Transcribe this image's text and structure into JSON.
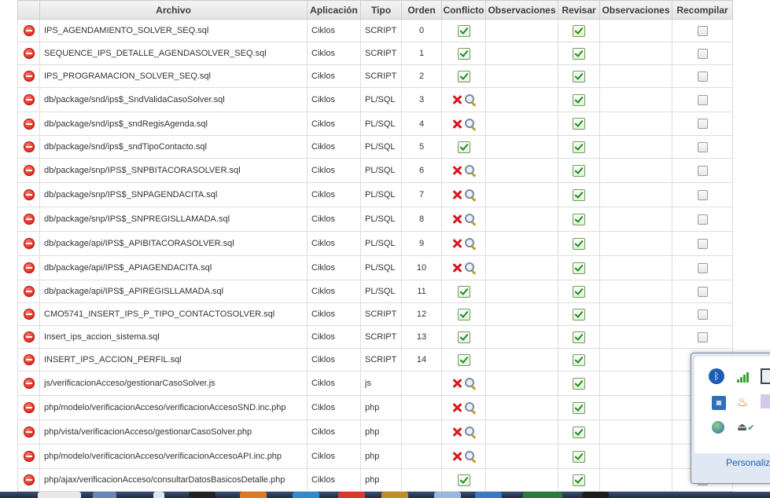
{
  "columns": [
    "Archivo",
    "Aplicación",
    "Tipo",
    "Orden",
    "Conflicto",
    "Observaciones",
    "Revisar",
    "Observaciones",
    "Recompilar"
  ],
  "rows": [
    {
      "archivo": "IPS_AGENDAMIENTO_SOLVER_SEQ.sql",
      "aplicacion": "Ciklos",
      "tipo": "SCRIPT",
      "orden": "0",
      "conflict": false
    },
    {
      "archivo": "SEQUENCE_IPS_DETALLE_AGENDASOLVER_SEQ.sql",
      "aplicacion": "Ciklos",
      "tipo": "SCRIPT",
      "orden": "1",
      "conflict": false
    },
    {
      "archivo": "IPS_PROGRAMACION_SOLVER_SEQ.sql",
      "aplicacion": "Ciklos",
      "tipo": "SCRIPT",
      "orden": "2",
      "conflict": false
    },
    {
      "archivo": "db/package/snd/ips$_SndValidaCasoSolver.sql",
      "aplicacion": "Ciklos",
      "tipo": "PL/SQL",
      "orden": "3",
      "conflict": true
    },
    {
      "archivo": "db/package/snd/ips$_sndRegisAgenda.sql",
      "aplicacion": "Ciklos",
      "tipo": "PL/SQL",
      "orden": "4",
      "conflict": true
    },
    {
      "archivo": "db/package/snd/ips$_sndTipoContacto.sql",
      "aplicacion": "Ciklos",
      "tipo": "PL/SQL",
      "orden": "5",
      "conflict": false
    },
    {
      "archivo": "db/package/snp/IPS$_SNPBITACORASOLVER.sql",
      "aplicacion": "Ciklos",
      "tipo": "PL/SQL",
      "orden": "6",
      "conflict": true
    },
    {
      "archivo": "db/package/snp/IPS$_SNPAGENDACITA.sql",
      "aplicacion": "Ciklos",
      "tipo": "PL/SQL",
      "orden": "7",
      "conflict": true
    },
    {
      "archivo": "db/package/snp/IPS$_SNPREGISLLAMADA.sql",
      "aplicacion": "Ciklos",
      "tipo": "PL/SQL",
      "orden": "8",
      "conflict": true
    },
    {
      "archivo": "db/package/api/IPS$_APIBITACORASOLVER.sql",
      "aplicacion": "Ciklos",
      "tipo": "PL/SQL",
      "orden": "9",
      "conflict": true
    },
    {
      "archivo": "db/package/api/IPS$_APIAGENDACITA.sql",
      "aplicacion": "Ciklos",
      "tipo": "PL/SQL",
      "orden": "10",
      "conflict": true
    },
    {
      "archivo": "db/package/api/IPS$_APIREGISLLAMADA.sql",
      "aplicacion": "Ciklos",
      "tipo": "PL/SQL",
      "orden": "11",
      "conflict": false
    },
    {
      "archivo": "CMO5741_INSERT_IPS_P_TIPO_CONTACTOSOLVER.sql",
      "aplicacion": "Ciklos",
      "tipo": "SCRIPT",
      "orden": "12",
      "conflict": false
    },
    {
      "archivo": "Insert_ips_accion_sistema.sql",
      "aplicacion": "Ciklos",
      "tipo": "SCRIPT",
      "orden": "13",
      "conflict": false
    },
    {
      "archivo": "INSERT_IPS_ACCION_PERFIL.sql",
      "aplicacion": "Ciklos",
      "tipo": "SCRIPT",
      "orden": "14",
      "conflict": false
    },
    {
      "archivo": "js/verificacionAcceso/gestionarCasoSolver.js",
      "aplicacion": "Ciklos",
      "tipo": "js",
      "orden": "",
      "conflict": true
    },
    {
      "archivo": "php/modelo/verificacionAcceso/verificacionAccesoSND.inc.php",
      "aplicacion": "Ciklos",
      "tipo": "php",
      "orden": "",
      "conflict": true
    },
    {
      "archivo": "php/vista/verificacionAcceso/gestionarCasoSolver.php",
      "aplicacion": "Ciklos",
      "tipo": "php",
      "orden": "",
      "conflict": true
    },
    {
      "archivo": "php/modelo/verificacionAcceso/verificacionAccesoAPI.inc.php",
      "aplicacion": "Ciklos",
      "tipo": "php",
      "orden": "",
      "conflict": true
    },
    {
      "archivo": "php/ajax/verificacionAcceso/consultarDatosBasicosDetalle.php",
      "aplicacion": "Ciklos",
      "tipo": "php",
      "orden": "",
      "conflict": false
    }
  ],
  "row_heights": [
    29,
    29,
    29,
    31,
    30,
    29,
    31,
    31,
    31,
    31,
    31,
    29,
    29,
    29,
    29,
    31,
    31,
    31,
    31,
    29
  ],
  "tray": {
    "link": "Personaliza"
  },
  "icons": {
    "remove": "remove-icon",
    "ok": "checkmark-icon",
    "conflict": "red-x-icon",
    "view": "magnifier-icon"
  }
}
